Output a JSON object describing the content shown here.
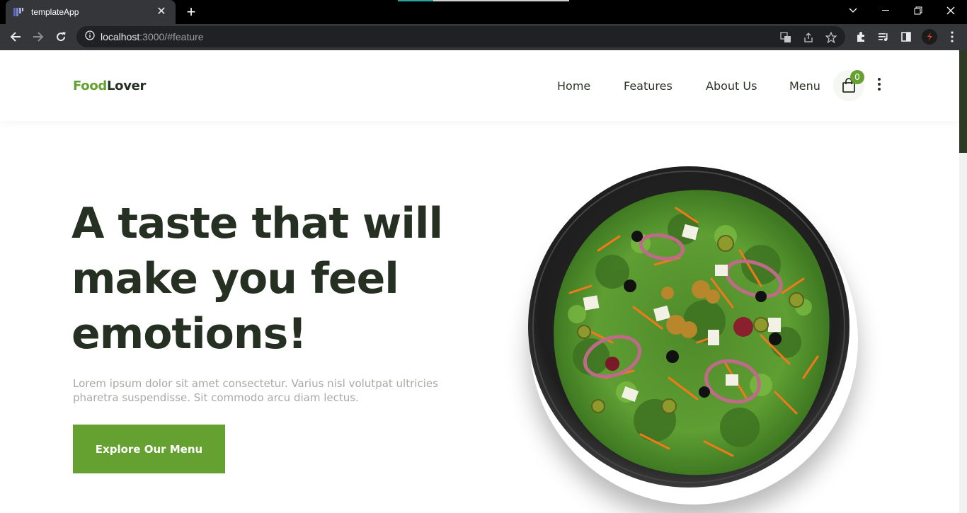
{
  "browser": {
    "tab_title": "templateApp",
    "url_host": "localhost",
    "url_rest": ":3000/#feature"
  },
  "site": {
    "logo_part1": "Food",
    "logo_part2": "Lover",
    "nav": [
      "Home",
      "Features",
      "About Us",
      "Menu"
    ],
    "cart_count": "0"
  },
  "hero": {
    "title_lines": [
      "A taste that will",
      "make you feel",
      "emotions!"
    ],
    "subtitle": "Lorem ipsum dolor sit amet consectetur. Varius nisl volutpat ultricies pharetra suspendisse. Sit commodo arcu diam lectus.",
    "button_label": "Explore Our Menu"
  },
  "colors": {
    "brand_green": "#65a130",
    "dark_text": "#263022",
    "muted_text": "#a7aaa5"
  }
}
